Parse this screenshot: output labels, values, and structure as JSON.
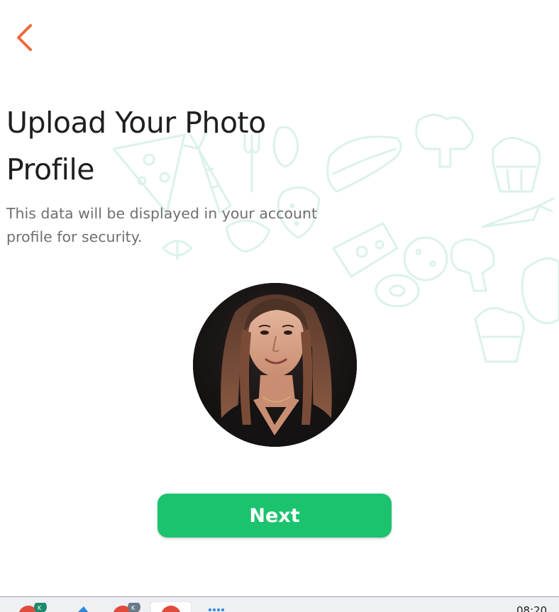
{
  "header": {
    "back_icon": "chevron-left-icon",
    "accent_color": "#f0683a"
  },
  "content": {
    "title": "Upload Your Photo Profile",
    "subtitle": "This data will be displayed in your account profile for security."
  },
  "next_button": {
    "label": "Next",
    "color": "#1cc36f"
  },
  "taskbar": {
    "clock": "08:20",
    "icons": [
      "app-icon",
      "app-icon",
      "app-icon",
      "app-icon",
      "app-icon"
    ]
  }
}
